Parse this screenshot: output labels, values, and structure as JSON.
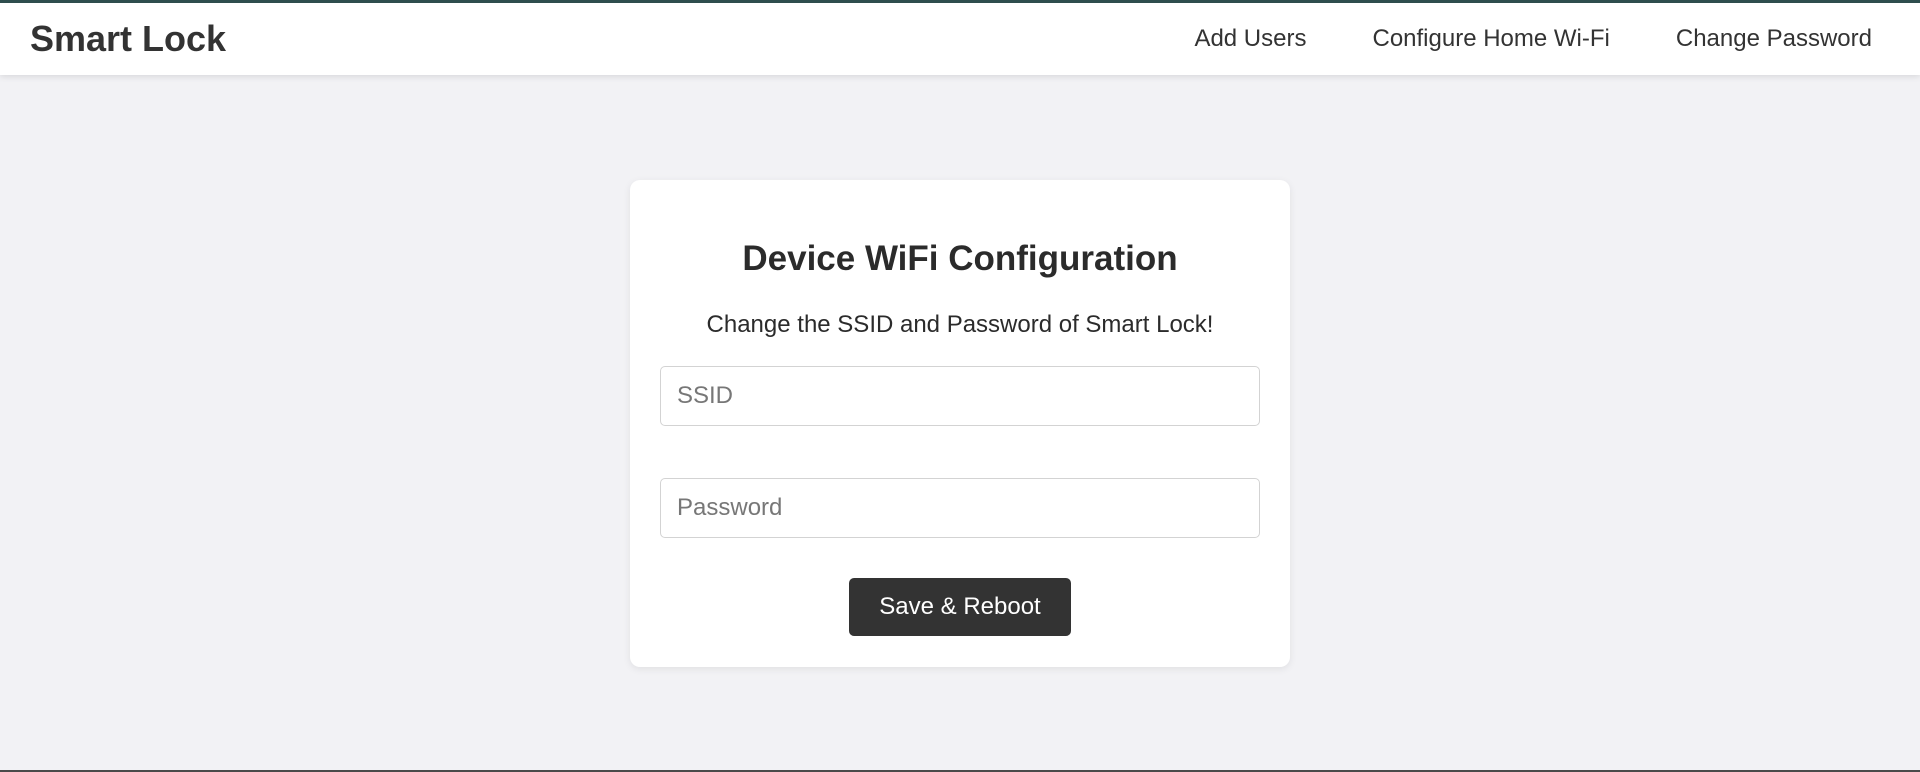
{
  "app": {
    "brand": "Smart Lock"
  },
  "nav": {
    "items": [
      {
        "label": "Add Users"
      },
      {
        "label": "Configure Home Wi-Fi"
      },
      {
        "label": "Change Password"
      }
    ]
  },
  "card": {
    "title": "Device WiFi Configuration",
    "subtitle": "Change the SSID and Password of Smart Lock!",
    "ssid": {
      "value": "",
      "placeholder": "SSID"
    },
    "password": {
      "value": "",
      "placeholder": "Password"
    },
    "submit_label": "Save & Reboot"
  },
  "colors": {
    "accent_top": "#2f4f4f",
    "button_bg": "#333333",
    "page_bg": "#f2f2f5"
  }
}
